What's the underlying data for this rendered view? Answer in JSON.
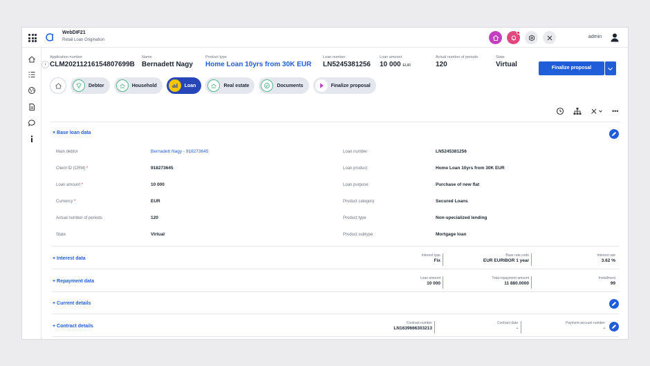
{
  "app": {
    "title": "WebDIF21",
    "subtitle": "Retail Loan Origination",
    "user": "admin"
  },
  "header": {
    "fields": [
      {
        "label": "Application number",
        "value": "CLM20211216154807699B"
      },
      {
        "label": "Name",
        "value": "Bernadett Nagy"
      },
      {
        "label": "Product type",
        "value": "Home Loan 10yrs from 30K EUR"
      },
      {
        "label": "Loan number",
        "value": "LN5245381256"
      },
      {
        "label": "Loan amount",
        "value": "10 000",
        "unit": "EUR"
      },
      {
        "label": "Actual number of periods",
        "value": "120"
      },
      {
        "label": "State",
        "value": "Virtual"
      }
    ],
    "finalize_button": "Finalize proposal"
  },
  "steps": [
    {
      "label": "Debtor",
      "icon": "id-card-icon"
    },
    {
      "label": "Household",
      "icon": "house-hand-icon"
    },
    {
      "label": "Loan",
      "icon": "chart-bars-icon",
      "active": true
    },
    {
      "label": "Real estate",
      "icon": "house-hand-icon"
    },
    {
      "label": "Documents",
      "icon": "check-circle-icon"
    },
    {
      "label": "Finalize proposal",
      "icon": "play-icon"
    }
  ],
  "base_loan": {
    "title": "Base loan data",
    "left": [
      {
        "label": "Main debtor",
        "value": "Bernadett Nagy - 918273645",
        "link": true
      },
      {
        "label": "Client ID (CRM)",
        "required": true,
        "value": "918273645"
      },
      {
        "label": "Loan amount",
        "required": true,
        "value": "10 000"
      },
      {
        "label": "Currency",
        "required": true,
        "value": "EUR"
      },
      {
        "label": "Actual number of periods",
        "value": "120"
      },
      {
        "label": "State",
        "value": "Virtual"
      }
    ],
    "right": [
      {
        "label": "Loan number",
        "value": "LN5245381256"
      },
      {
        "label": "Loan product",
        "value": "Home Loan 10yrs from 30K EUR"
      },
      {
        "label": "Loan purpose",
        "value": "Purchase of new flat"
      },
      {
        "label": "Product category",
        "value": "Secured Loans"
      },
      {
        "label": "Product type",
        "value": "Non-specialized lending"
      },
      {
        "label": "Product subtype",
        "value": "Mortgage loan"
      }
    ]
  },
  "sections": {
    "interest": {
      "title": "Interest data",
      "summary": [
        {
          "label": "Interest type",
          "value": "Fix"
        },
        {
          "label": "Base rate code",
          "value": "EUR EURIBOR 1 year"
        },
        {
          "label": "Interest rate",
          "value": "3.62 %"
        }
      ]
    },
    "repayment": {
      "title": "Repayment data",
      "summary": [
        {
          "label": "Loan amount",
          "value": "10 000"
        },
        {
          "label": "Total repayment amount",
          "value": "11 880.0000"
        },
        {
          "label": "Installment",
          "value": "99"
        }
      ]
    },
    "current": {
      "title": "Current details"
    },
    "contract": {
      "title": "Contract details",
      "summary": [
        {
          "label": "Contract number",
          "value": "LN1639666303213"
        },
        {
          "label": "Contract date",
          "value": "-"
        },
        {
          "label": "Payment account number",
          "value": "-"
        }
      ]
    }
  },
  "colors": {
    "accent": "#1f5ed8",
    "active_step": "#2747b8",
    "brand": "#c23fbf"
  }
}
